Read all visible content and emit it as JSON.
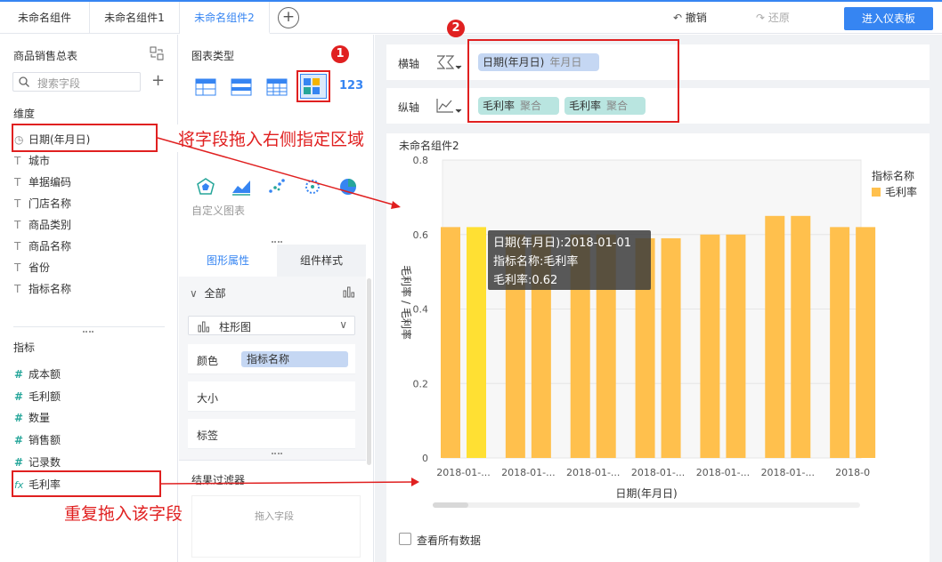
{
  "tabs": [
    "未命名组件",
    "未命名组件1",
    "未命名组件2"
  ],
  "toolbar": {
    "undo": "撤销",
    "redo": "还原",
    "enter_dashboard": "进入仪表板"
  },
  "left": {
    "dataset_title": "商品销售总表",
    "search_placeholder": "搜索字段",
    "dimension_label": "维度",
    "dimensions": [
      {
        "icon": "clock-icon",
        "label": "日期(年月日)"
      },
      {
        "icon": "text-icon",
        "label": "城市"
      },
      {
        "icon": "text-icon",
        "label": "单据编码"
      },
      {
        "icon": "text-icon",
        "label": "门店名称"
      },
      {
        "icon": "text-icon",
        "label": "商品类别"
      },
      {
        "icon": "text-icon",
        "label": "商品名称"
      },
      {
        "icon": "text-icon",
        "label": "省份"
      },
      {
        "icon": "text-icon",
        "label": "指标名称"
      }
    ],
    "measure_label": "指标",
    "measures": [
      {
        "icon": "hash-icon",
        "label": "成本额"
      },
      {
        "icon": "hash-icon",
        "label": "毛利额"
      },
      {
        "icon": "hash-icon",
        "label": "数量"
      },
      {
        "icon": "hash-icon",
        "label": "销售额"
      },
      {
        "icon": "hash-icon",
        "label": "记录数"
      },
      {
        "icon": "fx-icon",
        "label": "毛利率"
      }
    ]
  },
  "middle": {
    "chart_type_title": "图表类型",
    "custom_chart": "自定义图表",
    "tab_graphic": "图形属性",
    "tab_component": "组件样式",
    "all_label": "全部",
    "chart_select": "柱形图",
    "color_label": "颜色",
    "color_field": "指标名称",
    "size_label": "大小",
    "tag_label": "标签",
    "filter_title": "结果过滤器",
    "filter_drop": "拖入字段"
  },
  "right": {
    "x_axis_label": "横轴",
    "x_pill": {
      "name": "日期(年月日)",
      "sub": "年月日"
    },
    "y_axis_label": "纵轴",
    "y_pills": [
      {
        "name": "毛利率",
        "sub": "聚合"
      },
      {
        "name": "毛利率",
        "sub": "聚合"
      }
    ],
    "widget_title": "未命名组件2",
    "show_all": "查看所有数据"
  },
  "annotations": {
    "badge1": "1",
    "badge2": "2",
    "callout1": "将字段拖入右侧指定区域",
    "callout2": "重复拖入该字段",
    "color": "#e02020"
  },
  "tooltip": {
    "line1": "日期(年月日):2018-01-01",
    "line2": "指标名称:毛利率",
    "line3": "毛利率:0.62"
  },
  "chart_data": {
    "type": "bar",
    "ylabel": "毛利率 / 毛利率",
    "xlabel": "日期(年月日)",
    "ylim": [
      0,
      0.8
    ],
    "y_ticks": [
      "0",
      "0.2",
      "0.4",
      "0.6",
      "0.8"
    ],
    "x_tick_labels": [
      "2018-01-...",
      "2018-01-...",
      "2018-01-...",
      "2018-01-...",
      "2018-01-...",
      "2018-01-...",
      "2018-0"
    ],
    "legend_title": "指标名称",
    "legend_item": "毛利率",
    "bar_color": "#ffc04d",
    "highlight_color": "#ffe033",
    "groups": [
      {
        "values": [
          0.62,
          0.62
        ]
      },
      {
        "values": [
          0.6,
          0.6
        ]
      },
      {
        "values": [
          0.6,
          0.6
        ]
      },
      {
        "values": [
          0.59,
          0.59
        ]
      },
      {
        "values": [
          0.6,
          0.6
        ]
      },
      {
        "values": [
          0.65,
          0.65
        ]
      },
      {
        "values": [
          0.62,
          0.62
        ]
      }
    ]
  }
}
